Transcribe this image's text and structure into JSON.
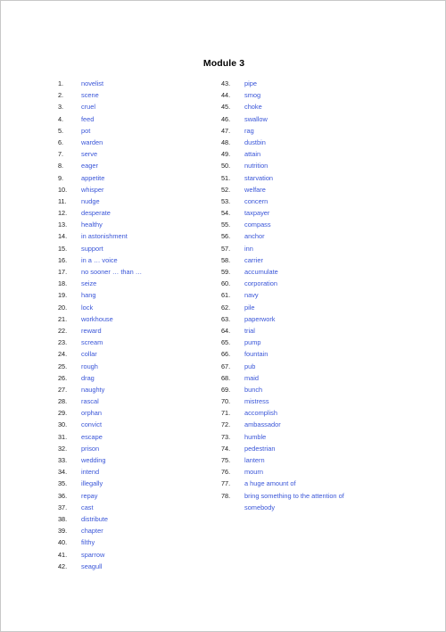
{
  "document": {
    "title": "Module 3",
    "word_color": "#3a56d8",
    "number_color": "#1a1a1a",
    "title_color": "#000000",
    "page_background": "#ffffff"
  },
  "columns": {
    "left": [
      {
        "number": "1.",
        "word": "novelist"
      },
      {
        "number": "2.",
        "word": "scene"
      },
      {
        "number": "3.",
        "word": "cruel"
      },
      {
        "number": "4.",
        "word": "feed"
      },
      {
        "number": "5.",
        "word": "pot"
      },
      {
        "number": "6.",
        "word": "warden"
      },
      {
        "number": "7.",
        "word": "serve"
      },
      {
        "number": "8.",
        "word": "eager"
      },
      {
        "number": "9.",
        "word": "appetite"
      },
      {
        "number": "10.",
        "word": "whisper"
      },
      {
        "number": "11.",
        "word": "nudge"
      },
      {
        "number": "12.",
        "word": "desperate"
      },
      {
        "number": "13.",
        "word": "healthy"
      },
      {
        "number": "14.",
        "word": "in astonishment"
      },
      {
        "number": "15.",
        "word": "support"
      },
      {
        "number": "16.",
        "word": "in a … voice"
      },
      {
        "number": "17.",
        "word": "no sooner … than …"
      },
      {
        "number": "18.",
        "word": "seize"
      },
      {
        "number": "19.",
        "word": "hang"
      },
      {
        "number": "20.",
        "word": "lock"
      },
      {
        "number": "21.",
        "word": "workhouse"
      },
      {
        "number": "22.",
        "word": "reward"
      },
      {
        "number": "23.",
        "word": "scream"
      },
      {
        "number": "24.",
        "word": "collar"
      },
      {
        "number": "25.",
        "word": "rough"
      },
      {
        "number": "26.",
        "word": "drag"
      },
      {
        "number": "27.",
        "word": "naughty"
      },
      {
        "number": "28.",
        "word": "rascal"
      },
      {
        "number": "29.",
        "word": "orphan"
      },
      {
        "number": "30.",
        "word": "convict"
      },
      {
        "number": "31.",
        "word": "escape"
      },
      {
        "number": "32.",
        "word": "prison"
      },
      {
        "number": "33.",
        "word": "wedding"
      },
      {
        "number": "34.",
        "word": "intend"
      },
      {
        "number": "35.",
        "word": "illegally"
      },
      {
        "number": "36.",
        "word": "repay"
      },
      {
        "number": "37.",
        "word": "cast"
      },
      {
        "number": "38.",
        "word": "distribute"
      },
      {
        "number": "39.",
        "word": "chapter"
      },
      {
        "number": "40.",
        "word": "filthy"
      },
      {
        "number": "41.",
        "word": "sparrow"
      },
      {
        "number": "42.",
        "word": "seagull"
      }
    ],
    "right": [
      {
        "number": "43.",
        "word": "pipe"
      },
      {
        "number": "44.",
        "word": "smog"
      },
      {
        "number": "45.",
        "word": "choke"
      },
      {
        "number": "46.",
        "word": "swallow"
      },
      {
        "number": "47.",
        "word": "rag"
      },
      {
        "number": "48.",
        "word": "dustbin"
      },
      {
        "number": "49.",
        "word": "attain"
      },
      {
        "number": "50.",
        "word": "nutrition"
      },
      {
        "number": "51.",
        "word": "starvation"
      },
      {
        "number": "52.",
        "word": "welfare"
      },
      {
        "number": "53.",
        "word": "concern"
      },
      {
        "number": "54.",
        "word": "taxpayer"
      },
      {
        "number": "55.",
        "word": "compass"
      },
      {
        "number": "56.",
        "word": "anchor"
      },
      {
        "number": "57.",
        "word": "inn"
      },
      {
        "number": "58.",
        "word": "carrier"
      },
      {
        "number": "59.",
        "word": "accumulate"
      },
      {
        "number": "60.",
        "word": "corporation"
      },
      {
        "number": "61.",
        "word": "navy"
      },
      {
        "number": "62.",
        "word": "pile"
      },
      {
        "number": "63.",
        "word": "paperwork"
      },
      {
        "number": "64.",
        "word": "trial"
      },
      {
        "number": "65.",
        "word": "pump"
      },
      {
        "number": "66.",
        "word": "fountain"
      },
      {
        "number": "67.",
        "word": "pub"
      },
      {
        "number": "68.",
        "word": "maid"
      },
      {
        "number": "69.",
        "word": "bunch"
      },
      {
        "number": "70.",
        "word": "mistress"
      },
      {
        "number": "71.",
        "word": "accomplish"
      },
      {
        "number": "72.",
        "word": "ambassador"
      },
      {
        "number": "73.",
        "word": "humble"
      },
      {
        "number": "74.",
        "word": "pedestrian"
      },
      {
        "number": "75.",
        "word": "lantern"
      },
      {
        "number": "76.",
        "word": "mourn"
      },
      {
        "number": "77.",
        "word": "a huge amount of"
      },
      {
        "number": "78.",
        "word": "bring something to the attention of",
        "word_line2": "somebody"
      }
    ]
  }
}
